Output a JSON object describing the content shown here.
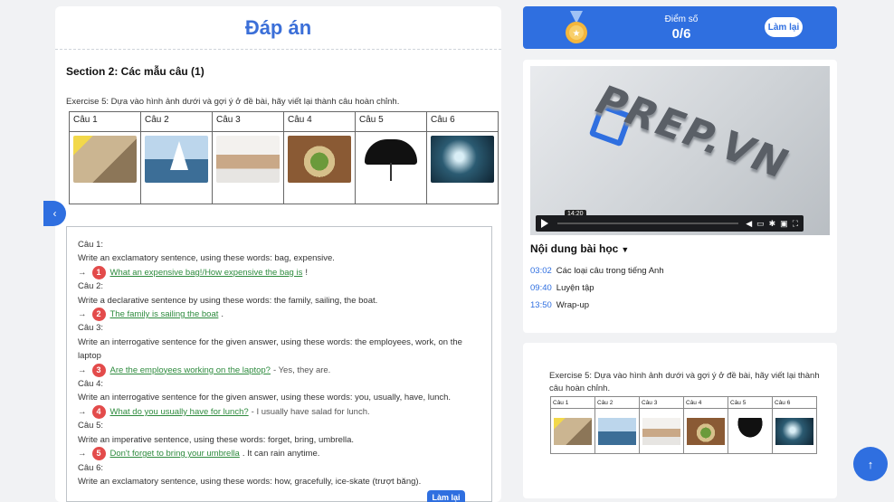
{
  "main": {
    "title": "Đáp án",
    "section_title": "Section 2: Các mẫu câu (1)",
    "exercise": "Exercise 5: Dựa vào hình ảnh dưới và gợi ý ở đề bài, hãy viết lại thành câu hoàn chỉnh.",
    "columns": [
      "Câu 1",
      "Câu 2",
      "Câu 3",
      "Câu 4",
      "Câu 5",
      "Câu 6"
    ],
    "image_icons": [
      "bag-photo",
      "sailboat-photo",
      "family-laptop-photo",
      "salad-photo",
      "umbrella-photo",
      "ice-skater-photo"
    ],
    "questions": [
      {
        "label": "Câu 1:",
        "prompt": "Write an exclamatory sentence, using these words: bag, expensive.",
        "num": "1",
        "answer": "What an expensive bag!/How expensive the bag is",
        "tail": "!"
      },
      {
        "label": "Câu 2:",
        "prompt": "Write a declarative sentence by using these words: the family, sailing, the boat.",
        "num": "2",
        "answer": "The family is sailing the boat",
        "tail": "."
      },
      {
        "label": "Câu 3:",
        "prompt": "Write an interrogative sentence for the given answer, using these words: the employees, work, on the laptop",
        "num": "3",
        "answer": "Are the employees working on the laptop?",
        "tail": "- Yes, they are."
      },
      {
        "label": "Câu 4:",
        "prompt": "Write an interrogative sentence for the given answer, using these words: you, usually, have, lunch.",
        "num": "4",
        "answer": "What do you usually have for lunch?",
        "tail": "- I usually have salad for lunch."
      },
      {
        "label": "Câu 5:",
        "prompt": "Write an imperative sentence, using these words: forget, bring, umbrella.",
        "num": "5",
        "answer": "Don't forget to bring your umbrella",
        "tail": ". It can rain anytime."
      },
      {
        "label": "Câu 6:",
        "prompt": "Write an exclamatory sentence, using these words: how, gracefully, ice-skate (trượt băng)."
      }
    ]
  },
  "score": {
    "label": "Điểm số",
    "value": "0/6",
    "retry": "Làm lại"
  },
  "video": {
    "logo": "PREP.VN",
    "time": "14:20"
  },
  "lesson": {
    "heading": "Nội dung bài học",
    "items": [
      {
        "time": "03:02",
        "title": "Các loại câu trong tiếng Anh"
      },
      {
        "time": "09:40",
        "title": "Luyện tập"
      },
      {
        "time": "13:50",
        "title": "Wrap-up"
      }
    ]
  },
  "preview": {
    "exercise": "Exercise 5: Dựa vào hình ảnh dưới và gợi ý ở đề bài, hãy viết lại thành câu hoàn chỉnh.",
    "columns": [
      "Câu 1",
      "Câu 2",
      "Câu 3",
      "Câu 4",
      "Câu 5",
      "Câu 6"
    ]
  },
  "bottom": {
    "retry": "Làm lại"
  },
  "colors": {
    "accent": "#2f6fe0",
    "answer": "#2e8b3e",
    "badge": "#e34b4b"
  }
}
